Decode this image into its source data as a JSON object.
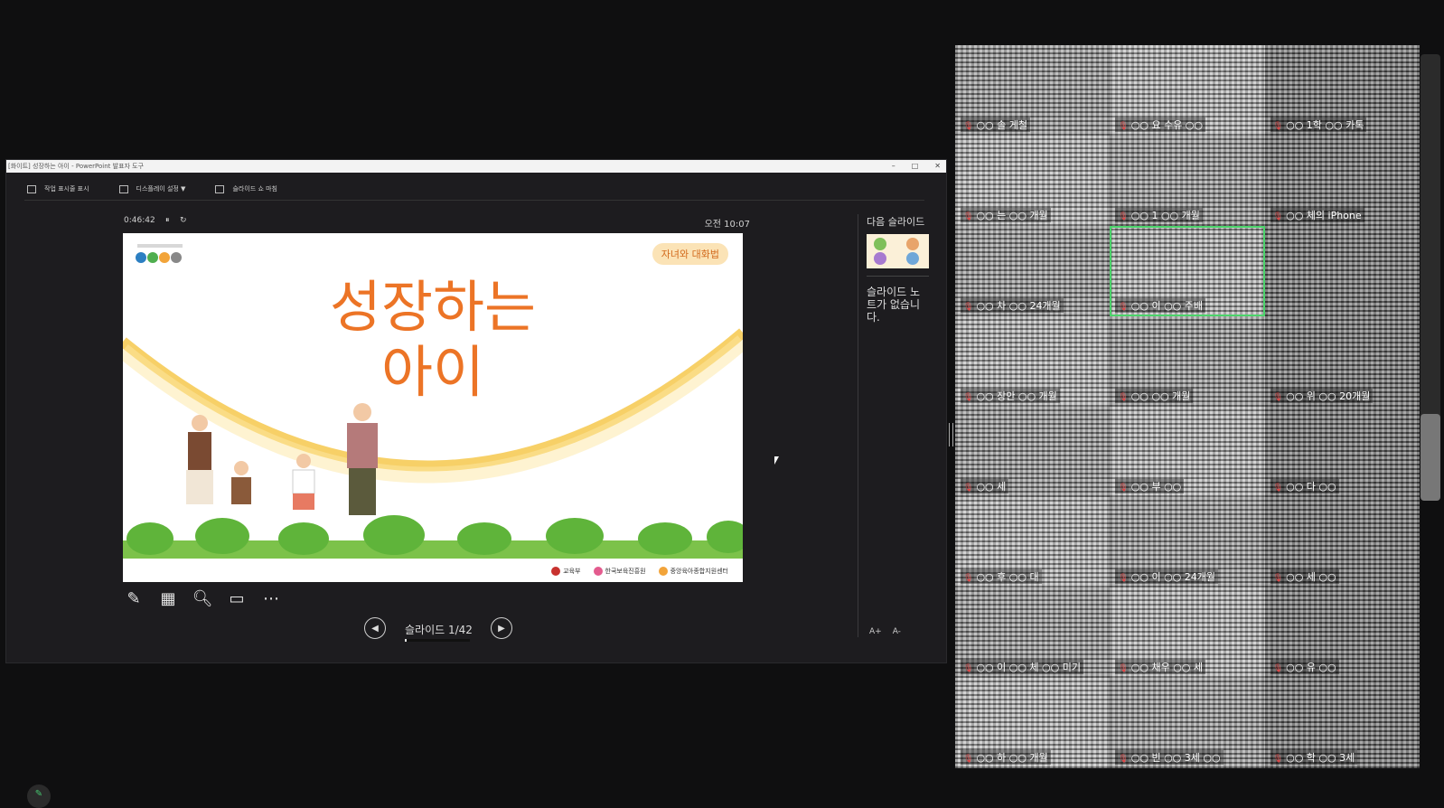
{
  "window": {
    "title": "[화이트] 성장하는 아이 - PowerPoint 발표자 도구",
    "controls": [
      "–",
      "□",
      "✕"
    ]
  },
  "toolbar": {
    "items": [
      {
        "label": "작업 표시줄 표시",
        "icon": "taskbar-icon"
      },
      {
        "label": "디스플레이 설정 ▼",
        "icon": "display-icon"
      },
      {
        "label": "슬라이드 쇼 마침",
        "icon": "end-show-icon"
      }
    ]
  },
  "presenter": {
    "timer": "0:46:42",
    "pause_icon": "⏸",
    "reset_icon": "↻",
    "clock": "오전 10:07"
  },
  "slide": {
    "tag": "자녀와 대화법",
    "title_line1": "성장하는",
    "title_line2": "아이",
    "logos": [
      "교육부",
      "한국보육진흥원",
      "중앙육아종합지원센터"
    ]
  },
  "tools": [
    "pen-icon",
    "slides-grid-icon",
    "zoom-icon",
    "screen-icon",
    "more-icon"
  ],
  "nav": {
    "prev": "◀",
    "next": "▶",
    "label": "슬라이드 1/42",
    "progress": 0.024
  },
  "notes": {
    "next_label": "다음 슬라이드",
    "text": "슬라이드 노트가 없습니다.",
    "font_up": "A+",
    "font_down": "A-"
  },
  "gallery": {
    "active_index": 7,
    "tiles": [
      {
        "name": "○○ 솔 게철"
      },
      {
        "name": "○○ 요 수유 ○○"
      },
      {
        "name": "○○ 1학 ○○ 카톡"
      },
      {
        "name": "○○ 는 ○○ 개월"
      },
      {
        "name": "○○ 1 ○○ 개월"
      },
      {
        "name": "○○ 체의 iPhone"
      },
      {
        "name": "○○ 차 ○○ 24개월"
      },
      {
        "name": "○○ 이 ○○ 주배"
      },
      {
        "name": ""
      },
      {
        "name": "○○ 장안 ○○ 개월"
      },
      {
        "name": "○○ ○○ 개월"
      },
      {
        "name": "○○ 위 ○○ 20개월"
      },
      {
        "name": "○○ 세"
      },
      {
        "name": "○○ 부 ○○"
      },
      {
        "name": "○○ 다 ○○"
      },
      {
        "name": "○○ 후 ○○ 대"
      },
      {
        "name": "○○ 이 ○○ 24개월"
      },
      {
        "name": "○○ 세 ○○"
      },
      {
        "name": "○○ 이 ○○ 체 ○○ 미기"
      },
      {
        "name": "○○ 채우 ○○ 세"
      },
      {
        "name": "○○ 유 ○○"
      },
      {
        "name": "○○ 하 ○○ 개월"
      },
      {
        "name": "○○ 빈 ○○ 3세 ○○"
      },
      {
        "name": "○○ 학 ○○ 3세"
      }
    ]
  }
}
